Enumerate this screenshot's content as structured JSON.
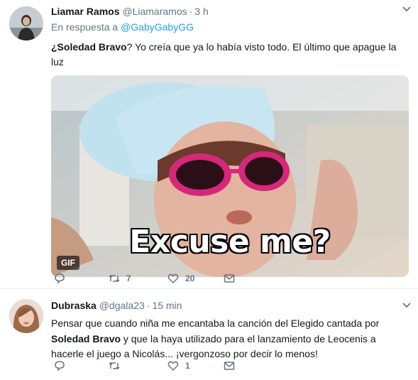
{
  "tweets": [
    {
      "name": "Liamar Ramos",
      "handle": "@Liamaramos",
      "separator": "·",
      "time": "3 h",
      "reply_prefix": "En respuesta a",
      "reply_to": "@GabyGabyGG",
      "text_bold": "¿Soledad Bravo",
      "text_rest": "? Yo creía que ya lo había visto todo. El último que apague la luz",
      "media": {
        "caption": "Excuse me?",
        "badge": "GIF"
      },
      "actions": {
        "reply": "",
        "retweets": "7",
        "likes": "20"
      }
    },
    {
      "name": "Dubraska",
      "handle": "@dgala23",
      "separator": "·",
      "time": "15 min",
      "text_part1": "Pensar que cuando niña me encantaba la canción del Elegido cantada por",
      "text_bold": "Soledad Bravo",
      "text_part2": " y que la haya utilizado para el lanzamiento de Leocenis a hacerle el juego a Nicolás... ¡vergonzoso por decir lo menos!",
      "actions": {
        "reply": "",
        "retweets": "",
        "likes": "1"
      }
    }
  ],
  "colors": {
    "link": "#1da1f2",
    "muted": "#657786",
    "text": "#14171a",
    "divider": "#e6ecf0"
  },
  "icons": [
    "chevron-down-icon",
    "reply-icon",
    "retweet-icon",
    "heart-icon",
    "direct-message-icon"
  ]
}
